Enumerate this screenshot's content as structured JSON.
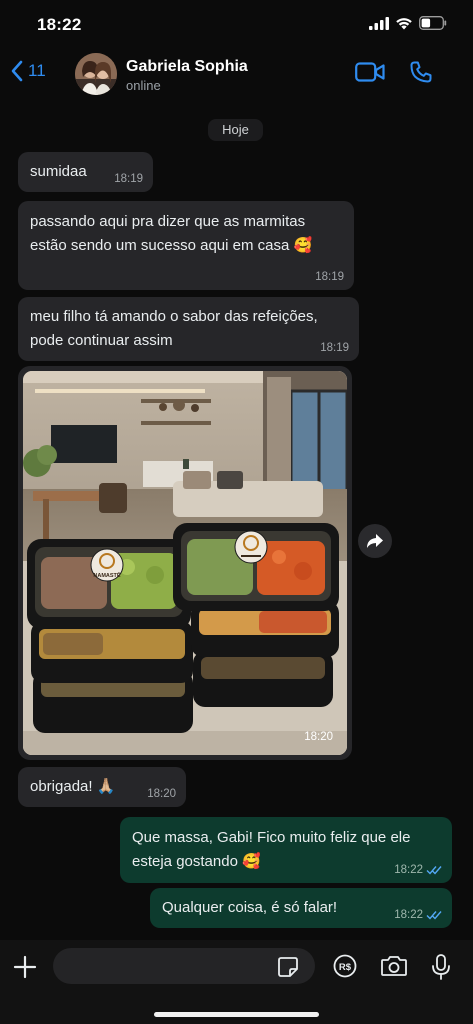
{
  "status_bar": {
    "time": "18:22"
  },
  "header": {
    "back_count": "11",
    "contact_name": "Gabriela Sophia",
    "contact_status": "online"
  },
  "chat": {
    "date_chip": "Hoje",
    "messages": [
      {
        "text": "sumidaa",
        "time": "18:19"
      },
      {
        "text_line1": "passando aqui pra dizer que as marmitas",
        "text_line2": "estão sendo um sucesso aqui em casa 🥰",
        "time": "18:19"
      },
      {
        "text_line1": "meu filho tá amando o sabor das refeições,",
        "text_line2": "pode continuar assim",
        "time": "18:19"
      },
      {
        "photo_time": "18:20",
        "label": "NAMASTÊ"
      },
      {
        "text": "obrigada! 🙏🏼",
        "time": "18:20"
      },
      {
        "text_line1": "Que massa, Gabi! Fico muito feliz que ele",
        "text_line2": "esteja gostando 🥰",
        "time": "18:22"
      },
      {
        "text": "Qualquer coisa, é só falar!",
        "time": "18:22"
      }
    ]
  },
  "composer": {
    "value": "",
    "pay_label": "R$"
  },
  "colors": {
    "accent": "#2f8cf0",
    "incoming": "#262629",
    "outgoing": "#0d3b2e",
    "read_tick": "#53a8f5"
  }
}
